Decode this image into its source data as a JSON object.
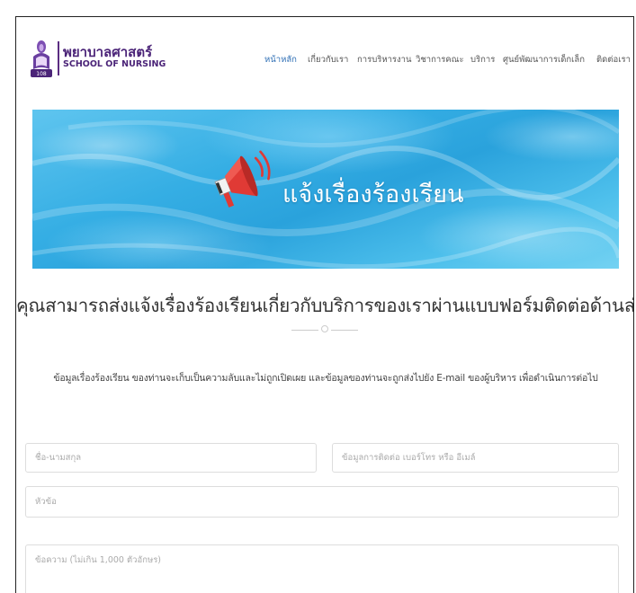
{
  "header": {
    "logo_th": "พยาบาลศาสตร์",
    "logo_en": "SCHOOL OF NURSING",
    "nav": [
      {
        "label": "หน้าหลัก",
        "active": true
      },
      {
        "label": "เกี่ยวกับเรา",
        "active": false
      },
      {
        "label": "การบริหารงาน",
        "active": false
      },
      {
        "label": "วิชาการคณะ",
        "active": false
      },
      {
        "label": "บริการ",
        "active": false
      },
      {
        "label": "ศูนย์พัฒนาการเด็กเล็ก",
        "active": false
      },
      {
        "label": "ติดต่อเรา",
        "active": false
      }
    ]
  },
  "banner": {
    "title": "แจ้งเรื่องร้องเรียน",
    "icon": "megaphone-icon"
  },
  "main": {
    "headline": "คุณสามารถส่งแจ้งเรื่องร้องเรียนเกี่ยวกับบริการของเราผ่านแบบฟอร์มติดต่อด้านล่าง",
    "info": "ข้อมูลเรื่องร้องเรียน ของท่านจะเก็บเป็นความลับและไม่ถูกเปิดเผย และข้อมูลของท่านจะถูกส่งไปยัง E-mail ของผู้บริหาร เพื่อดำเนินการต่อไป"
  },
  "form": {
    "name_placeholder": "ชื่อ-นามสกุล",
    "contact_placeholder": "ข้อมูลการติดต่อ เบอร์โทร หรือ อีเมล์",
    "subject_placeholder": "หัวข้อ",
    "message_placeholder": "ข้อความ (ไม่เกิน 1,000 ตัวอักษร)"
  },
  "colors": {
    "brand_purple": "#4b2478",
    "nav_active": "#2f6fb5",
    "banner_blue": "#2aa2dc",
    "megaphone_red": "#e03a35"
  }
}
